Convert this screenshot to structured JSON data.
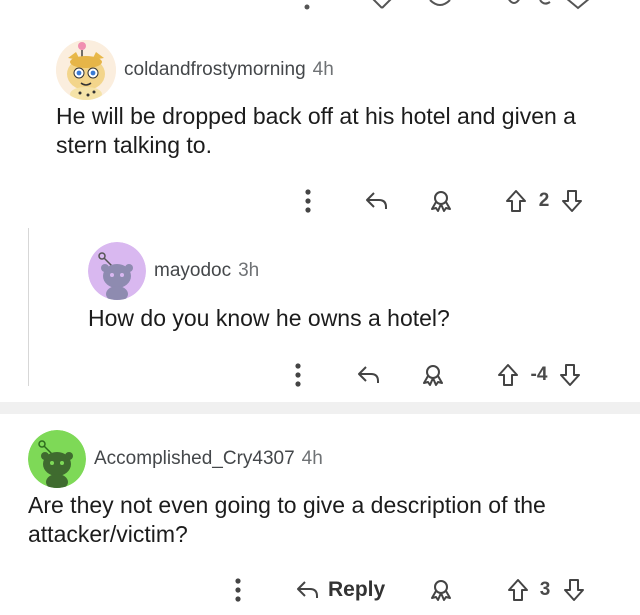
{
  "comments": [
    {
      "author": "coldandfrostymorning",
      "time": "4h",
      "body": "He will be dropped back off at his hotel and given a stern talking to.",
      "votes": "2"
    },
    {
      "author": "mayodoc",
      "time": "3h",
      "body": "How do you know he owns a hotel?",
      "votes": "-4"
    },
    {
      "author": "Accomplished_Cry4307",
      "time": "4h",
      "body": "Are they not even going to give a description of the attacker/victim?",
      "votes": "3",
      "reply_label": "Reply"
    }
  ],
  "icons": {
    "more": "more-vertical-icon",
    "reply": "reply-arrow-icon",
    "award": "award-icon",
    "upvote": "upvote-icon",
    "downvote": "downvote-icon"
  },
  "colors": {
    "avatar_purple": "#d9b8f0",
    "avatar_green": "#7ed957",
    "text": "#1c1c1c",
    "meta": "#6f7275",
    "separator": "#f0f0f0"
  }
}
